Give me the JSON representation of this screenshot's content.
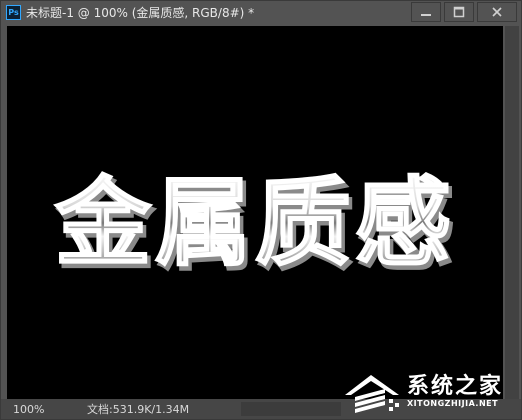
{
  "window": {
    "app_icon_label": "Ps",
    "title": "未标题-1 @ 100% (金属质感, RGB/8#) *",
    "controls": [
      "minimize-icon",
      "maximize-icon",
      "close-icon"
    ]
  },
  "canvas": {
    "background": "#000000",
    "text": "金属质感"
  },
  "status": {
    "zoom": "100%",
    "doc_info": "文档:531.9K/1.34M",
    "expand_arrow": "〉"
  },
  "watermark": {
    "cn": "系统之家",
    "en": "XITONGZHIJIA.NET"
  },
  "colors": {
    "chrome": "#535353",
    "ps_blue": "#31a8ff",
    "ps_dark": "#0c2134"
  }
}
